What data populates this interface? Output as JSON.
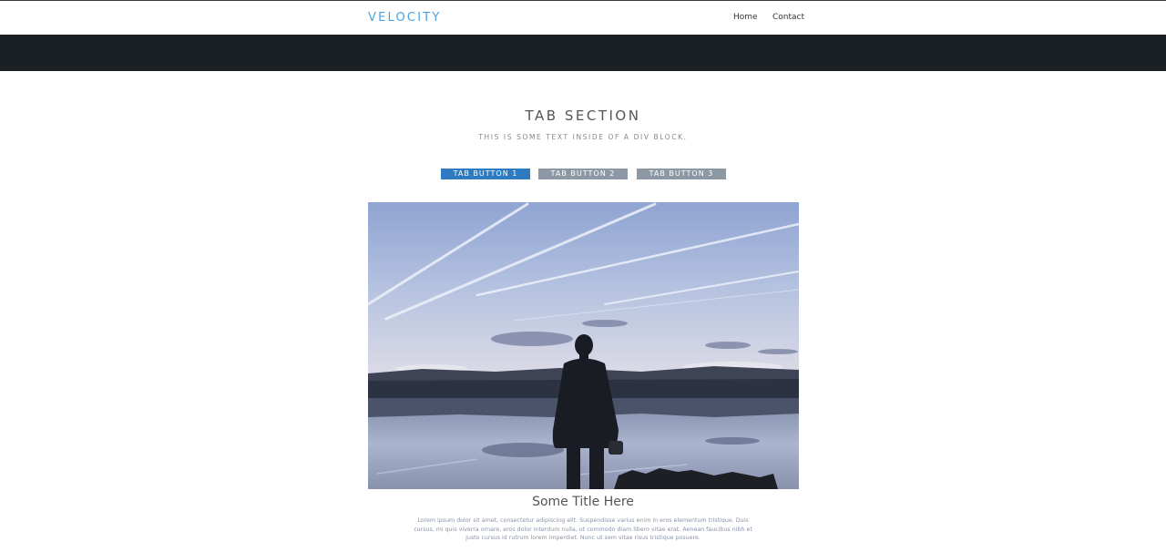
{
  "nav": {
    "brand": "VELOCITY",
    "links": [
      "Home",
      "Contact"
    ]
  },
  "section": {
    "title": "TAB SECTION",
    "subtitle": "THIS IS SOME TEXT INSIDE OF A DIV BLOCK."
  },
  "tabs": [
    {
      "label": "TAB BUTTON 1",
      "active": true
    },
    {
      "label": "TAB BUTTON 2",
      "active": false
    },
    {
      "label": "TAB BUTTON 3",
      "active": false
    }
  ],
  "card": {
    "title": "Some Title Here",
    "body": "Lorem ipsum dolor sit amet, consectetur adipiscing elit. Suspendisse varius enim in eros elementum tristique. Duis cursus, mi quis viverra ornare, eros dolor interdum nulla, ut commodo diam libero vitae erat. Aenean faucibus nibh et justo cursus id rutrum lorem imperdiet. Nunc ut sem vitae risus tristique posuere."
  },
  "colors": {
    "brand": "#4aa3df",
    "hero_band": "#1a2024",
    "tab_active": "#2f7bc1",
    "tab_inactive": "#8c98a4"
  }
}
